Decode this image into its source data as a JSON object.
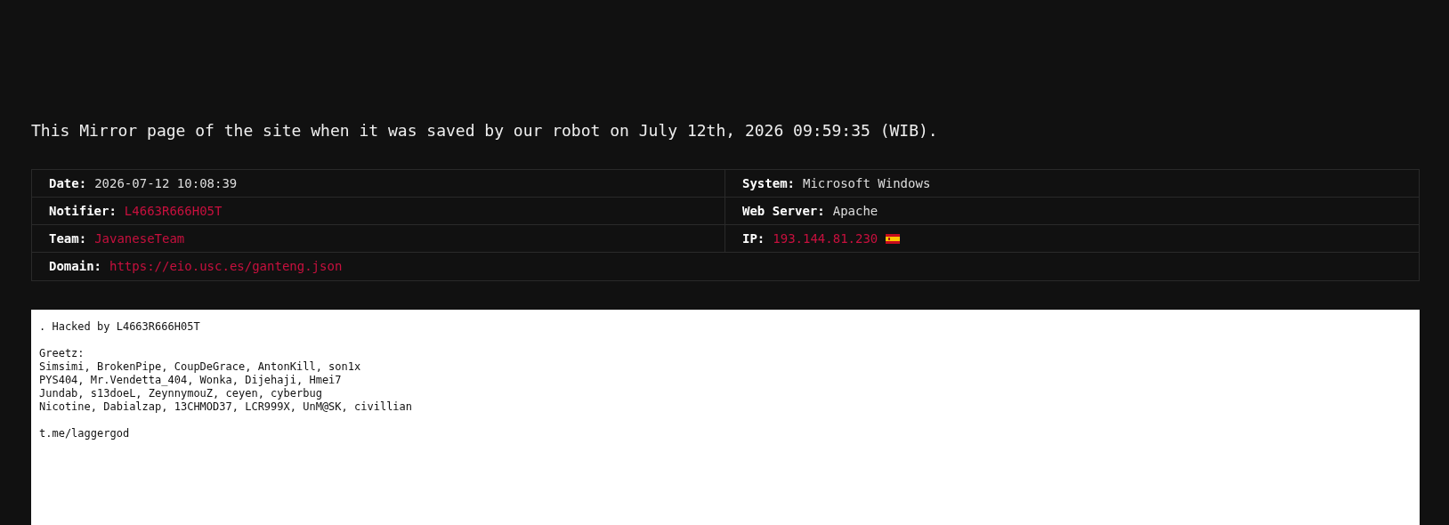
{
  "notice": "This Mirror page of the site when it was saved by our robot on July 12th, 2026 09:59:35 (WIB).",
  "info_rows": [
    {
      "cells": [
        {
          "label": "Date:",
          "value": "2026-07-12 10:08:39",
          "kind": "plain"
        },
        {
          "label": "System:",
          "value": "Microsoft Windows",
          "kind": "plain"
        }
      ]
    },
    {
      "cells": [
        {
          "label": "Notifier:",
          "value": "L4663R666H05T",
          "kind": "link"
        },
        {
          "label": "Web Server:",
          "value": "Apache",
          "kind": "plain"
        }
      ]
    },
    {
      "cells": [
        {
          "label": "Team:",
          "value": "JavaneseTeam",
          "kind": "link"
        },
        {
          "label": "IP:",
          "value": "193.144.81.230",
          "kind": "link",
          "flag": true
        }
      ]
    },
    {
      "cells": [
        {
          "label": "Domain:",
          "value": "https://eio.usc.es/ganteng.json",
          "kind": "link"
        }
      ]
    }
  ],
  "mirror": {
    "paragraphs": [
      [
        ". Hacked by L4663R666H05T"
      ],
      [
        "Greetz:",
        "Simsimi, BrokenPipe, CoupDeGrace, AntonKill, son1x",
        "PYS404, Mr.Vendetta_404, Wonka, Dijehaji, Hmei7",
        "Jundab, s13doeL, ZeynnymouZ, ceyen, cyberbug",
        "Nicotine, Dabialzap, 13CHMOD37, LCR999X, UnM@SK, civillian"
      ],
      [
        "t.me/laggergod"
      ]
    ]
  }
}
